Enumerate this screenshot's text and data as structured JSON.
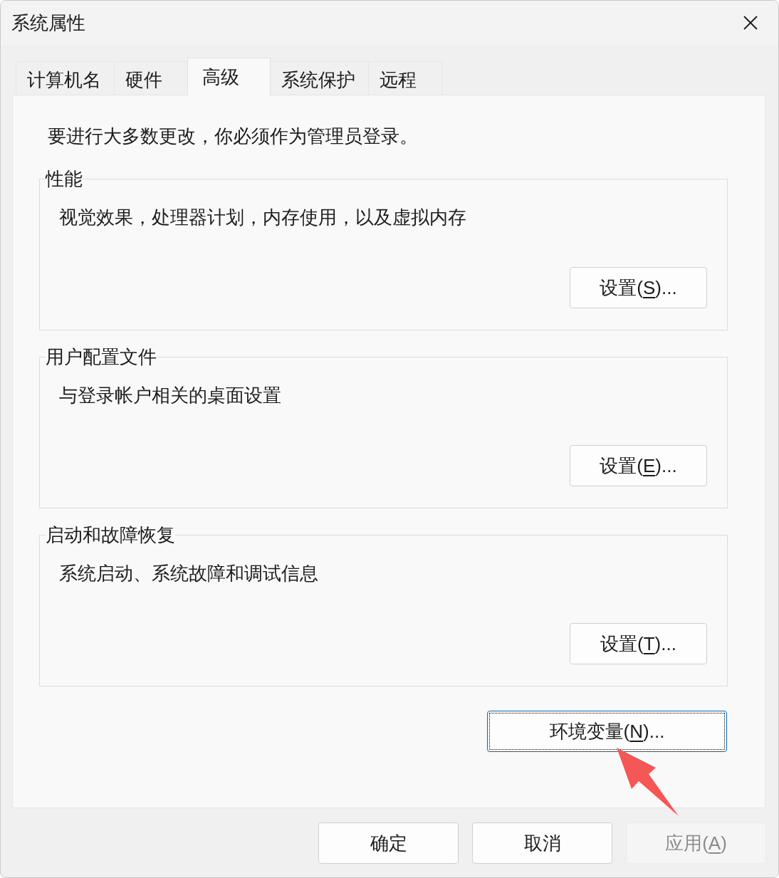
{
  "window": {
    "title": "系统属性"
  },
  "tabs": [
    {
      "label": "计算机名",
      "selected": false
    },
    {
      "label": "硬件",
      "selected": false
    },
    {
      "label": "高级",
      "selected": true
    },
    {
      "label": "系统保护",
      "selected": false
    },
    {
      "label": "远程",
      "selected": false
    }
  ],
  "notice": "要进行大多数更改，你必须作为管理员登录。",
  "groups": [
    {
      "title": "性能",
      "description": "视觉效果，处理器计划，内存使用，以及虚拟内存",
      "button": {
        "focused": false,
        "label": [
          {
            "kind": "plain",
            "text": "设置("
          },
          {
            "kind": "access_key",
            "text": "S"
          },
          {
            "kind": "plain",
            "text": ")..."
          }
        ]
      }
    },
    {
      "title": "用户配置文件",
      "description": "与登录帐户相关的桌面设置",
      "button": {
        "focused": false,
        "label": [
          {
            "kind": "plain",
            "text": "设置("
          },
          {
            "kind": "access_key",
            "text": "E"
          },
          {
            "kind": "plain",
            "text": ")..."
          }
        ]
      }
    },
    {
      "title": "启动和故障恢复",
      "description": "系统启动、系统故障和调试信息",
      "button": {
        "focused": false,
        "label": [
          {
            "kind": "plain",
            "text": "设置("
          },
          {
            "kind": "access_key",
            "text": "T"
          },
          {
            "kind": "plain",
            "text": ")..."
          }
        ]
      }
    }
  ],
  "environment_button": {
    "focused": true,
    "label": [
      {
        "kind": "plain",
        "text": "环境变量("
      },
      {
        "kind": "access_key",
        "text": "N"
      },
      {
        "kind": "plain",
        "text": ")..."
      }
    ]
  },
  "dialog_buttons": [
    {
      "disabled": false,
      "label": [
        {
          "kind": "plain",
          "text": "确定"
        }
      ]
    },
    {
      "disabled": false,
      "label": [
        {
          "kind": "plain",
          "text": "取消"
        }
      ]
    },
    {
      "disabled": true,
      "label": [
        {
          "kind": "plain",
          "text": "应用("
        },
        {
          "kind": "access_key",
          "text": "A"
        },
        {
          "kind": "plain",
          "text": ")"
        }
      ]
    }
  ],
  "annotation": {
    "kind": "arrow"
  }
}
